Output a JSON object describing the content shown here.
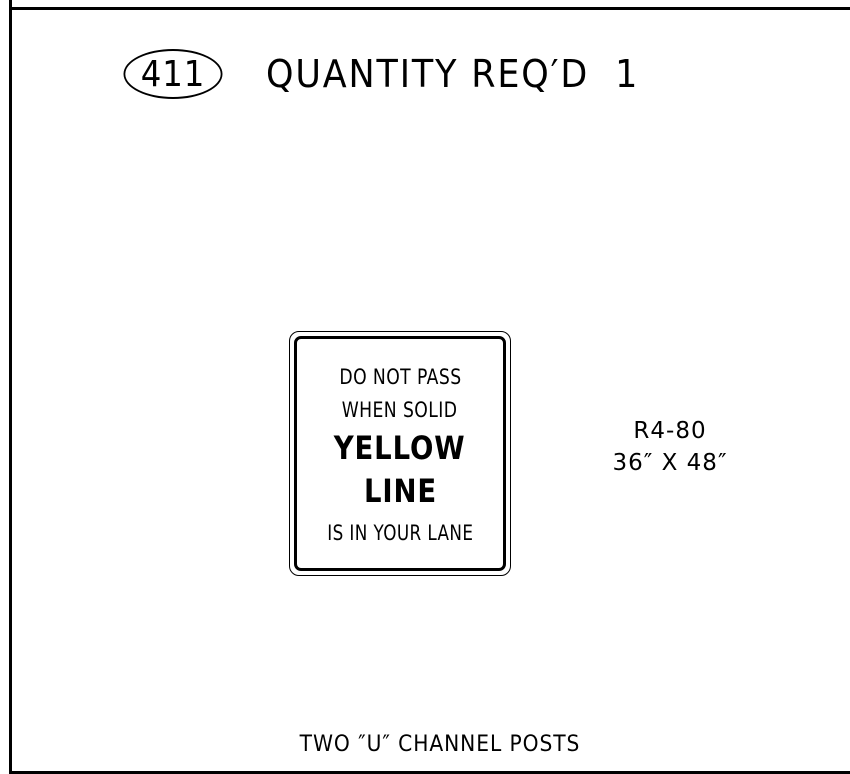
{
  "header": {
    "sign_number": "411",
    "quantity_text": "QUANTITY REQ′D  1"
  },
  "sign": {
    "line1": "DO NOT PASS",
    "line2": "WHEN SOLID",
    "line3": "YELLOW",
    "line4": "LINE",
    "line5": "IS IN YOUR LANE"
  },
  "sign_code": {
    "code": "R4-80",
    "size": "36″ X 48″"
  },
  "posts_note": "TWO ″U″ CHANNEL POSTS"
}
